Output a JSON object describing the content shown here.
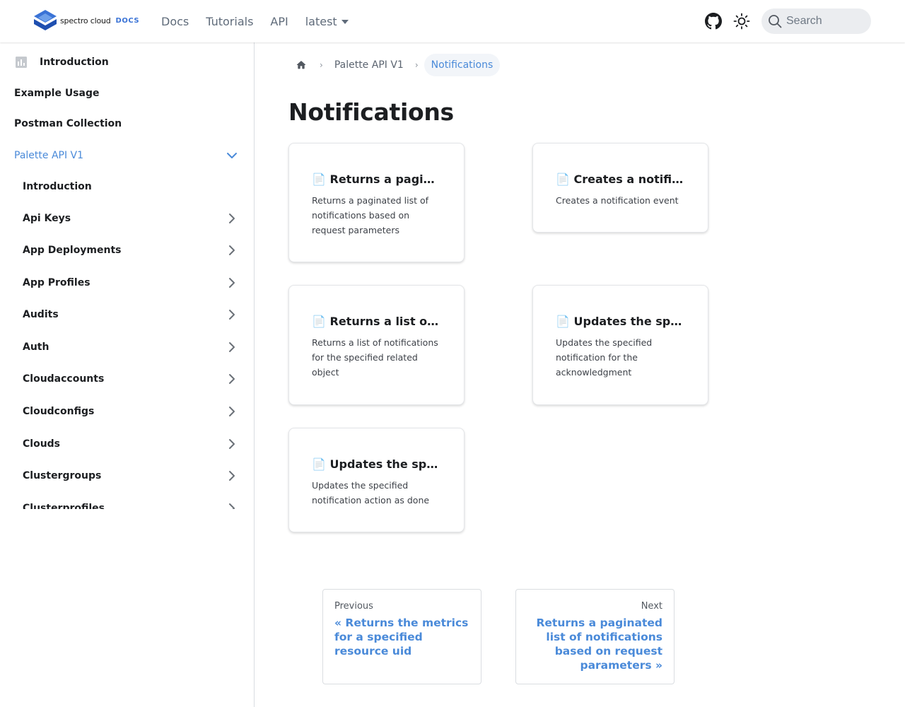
{
  "navbar": {
    "brand_name": "spectro cloud",
    "brand_docs": "DOCS",
    "links": [
      "Docs",
      "Tutorials",
      "API"
    ],
    "version": "latest",
    "search_placeholder": "Search"
  },
  "sidebar": {
    "top_items": [
      {
        "label": "Introduction",
        "icon": "document-icon"
      },
      {
        "label": "Example Usage"
      },
      {
        "label": "Postman Collection"
      },
      {
        "label": "Palette API V1",
        "active": true,
        "expanded": true
      }
    ],
    "sub_items": [
      {
        "label": "Introduction"
      },
      {
        "label": "Api Keys"
      },
      {
        "label": "App Deployments"
      },
      {
        "label": "App Profiles"
      },
      {
        "label": "Audits"
      },
      {
        "label": "Auth"
      },
      {
        "label": "Cloudaccounts"
      },
      {
        "label": "Cloudconfigs"
      },
      {
        "label": "Clouds"
      },
      {
        "label": "Clustergroups"
      },
      {
        "label": "Clusterprofiles"
      }
    ]
  },
  "breadcrumbs": {
    "items": [
      "Palette API V1"
    ],
    "current": "Notifications"
  },
  "page": {
    "title": "Notifications"
  },
  "cards": [
    {
      "title": "📄 Returns a paginated list of notifications based on request parameters",
      "desc": "Returns a paginated list of notifications based on request parameters"
    },
    {
      "title": "📄 Creates a notification event",
      "desc": "Creates a notification event"
    },
    {
      "title": "📄 Returns a list of notifications for the specified related object",
      "desc": "Returns a list of notifications for the specified related object"
    },
    {
      "title": "📄 Updates the specified notification for the acknowledgment",
      "desc": "Updates the specified notification for the acknowledgment"
    },
    {
      "title": "📄 Updates the specified notification action as done",
      "desc": "Updates the specified notification action as done"
    }
  ],
  "pagination": {
    "prev_sub": "Previous",
    "prev_label": "« Returns the metrics for a specified resource uid",
    "next_sub": "Next",
    "next_label": "Returns a paginated list of notifications based on request parameters »"
  },
  "colors": {
    "accent": "#4a8ad9",
    "brand_blue": "#3a73d6",
    "border": "#dadde1"
  }
}
